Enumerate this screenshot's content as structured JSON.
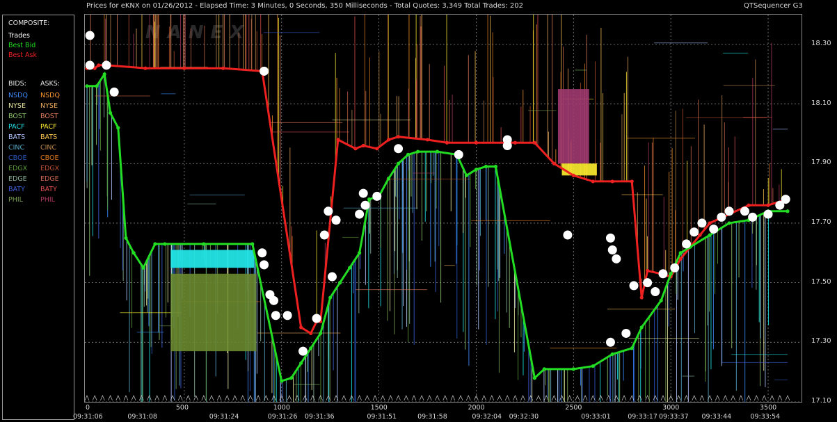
{
  "header": {
    "title": "Prices for  eKNX  on  01/26/2012  -  Elapsed Time: 3 Minutes, 0 Seconds, 350 Milliseconds  -  Total Quotes: 3,349  Total Trades: 202",
    "brand": "QTSequencer G3",
    "watermark": "NANEX"
  },
  "legend": {
    "composite_heading": "COMPOSITE:",
    "composite": [
      {
        "label": "Trades",
        "color": "#ffffff"
      },
      {
        "label": "Best Bid",
        "color": "#22dd22"
      },
      {
        "label": "Best Ask",
        "color": "#ee2020"
      }
    ],
    "bids_heading": "BIDS:",
    "asks_heading": "ASKS:",
    "bids": [
      {
        "label": "NSDQ",
        "color": "#3d8cff"
      },
      {
        "label": "NYSE",
        "color": "#e8e8a0"
      },
      {
        "label": "BOST",
        "color": "#8fc870"
      },
      {
        "label": "PACF",
        "color": "#22e4e4"
      },
      {
        "label": "BATS",
        "color": "#b0c8ff"
      },
      {
        "label": "CINC",
        "color": "#58a8c8"
      },
      {
        "label": "CBOE",
        "color": "#2c58c0"
      },
      {
        "label": "EDGX",
        "color": "#5a9a3a"
      },
      {
        "label": "EDGE",
        "color": "#8ab8a0"
      },
      {
        "label": "BATY",
        "color": "#4060d8"
      },
      {
        "label": "PHIL",
        "color": "#7aa050"
      }
    ],
    "asks": [
      {
        "label": "NSDQ",
        "color": "#ff9a30"
      },
      {
        "label": "NYSE",
        "color": "#f0b060"
      },
      {
        "label": "BOST",
        "color": "#e88060"
      },
      {
        "label": "PACF",
        "color": "#ffee30"
      },
      {
        "label": "BATS",
        "color": "#ffc850"
      },
      {
        "label": "CINC",
        "color": "#c08a50"
      },
      {
        "label": "CBOE",
        "color": "#e07a20"
      },
      {
        "label": "EDGX",
        "color": "#c05030"
      },
      {
        "label": "EDGE",
        "color": "#d06a50"
      },
      {
        "label": "BATY",
        "color": "#e05050"
      },
      {
        "label": "PHIL",
        "color": "#b03a60"
      }
    ]
  },
  "chart_data": {
    "type": "line",
    "title": "Prices for  eKNX  on  01/26/2012",
    "xlabel": "",
    "ylabel": "",
    "xlim": [
      0,
      3600
    ],
    "ylim": [
      17.1,
      18.4
    ],
    "grid": true,
    "x_ticks": [
      0,
      500,
      1000,
      1500,
      2000,
      2500,
      3000,
      3500
    ],
    "y_ticks": [
      17.1,
      17.3,
      17.5,
      17.7,
      17.9,
      18.1,
      18.3
    ],
    "y_tick_labels": [
      "17.10",
      "17.30",
      "17.50",
      "17.70",
      "17.90",
      "18.10",
      "18.30"
    ],
    "time_labels": [
      {
        "x": 0,
        "label": "09:31:06"
      },
      {
        "x": 280,
        "label": "09:31:08"
      },
      {
        "x": 700,
        "label": "09:31:24"
      },
      {
        "x": 1000,
        "label": "09:31:26"
      },
      {
        "x": 1190,
        "label": "09:31:36"
      },
      {
        "x": 1510,
        "label": "09:31:51"
      },
      {
        "x": 1770,
        "label": "09:31:58"
      },
      {
        "x": 2050,
        "label": "09:32:04"
      },
      {
        "x": 2240,
        "label": "09:32:30"
      },
      {
        "x": 2610,
        "label": "09:33:01"
      },
      {
        "x": 2850,
        "label": "09:33:17"
      },
      {
        "x": 3010,
        "label": "09:33:37"
      },
      {
        "x": 3230,
        "label": "09:33:44"
      },
      {
        "x": 3480,
        "label": "09:33:54"
      }
    ],
    "series": [
      {
        "name": "Best Ask",
        "color": "#ee2020",
        "points": [
          [
            0,
            18.22
          ],
          [
            40,
            18.22
          ],
          [
            60,
            18.23
          ],
          [
            100,
            18.23
          ],
          [
            300,
            18.22
          ],
          [
            500,
            18.22
          ],
          [
            700,
            18.22
          ],
          [
            900,
            18.21
          ],
          [
            1100,
            17.35
          ],
          [
            1150,
            17.33
          ],
          [
            1180,
            17.37
          ],
          [
            1200,
            17.37
          ],
          [
            1290,
            17.98
          ],
          [
            1380,
            17.95
          ],
          [
            1420,
            17.96
          ],
          [
            1490,
            17.95
          ],
          [
            1550,
            17.98
          ],
          [
            1600,
            17.99
          ],
          [
            1750,
            17.98
          ],
          [
            1850,
            17.97
          ],
          [
            2000,
            17.97
          ],
          [
            2200,
            17.97
          ],
          [
            2300,
            17.97
          ],
          [
            2400,
            17.9
          ],
          [
            2500,
            17.86
          ],
          [
            2600,
            17.84
          ],
          [
            2700,
            17.84
          ],
          [
            2800,
            17.84
          ],
          [
            2850,
            17.45
          ],
          [
            2880,
            17.54
          ],
          [
            2950,
            17.53
          ],
          [
            3000,
            17.52
          ],
          [
            3050,
            17.58
          ],
          [
            3150,
            17.66
          ],
          [
            3200,
            17.7
          ],
          [
            3300,
            17.73
          ],
          [
            3400,
            17.76
          ],
          [
            3500,
            17.76
          ],
          [
            3600,
            17.78
          ]
        ]
      },
      {
        "name": "Best Bid",
        "color": "#22dd22",
        "points": [
          [
            0,
            18.16
          ],
          [
            50,
            18.16
          ],
          [
            90,
            18.2
          ],
          [
            120,
            18.07
          ],
          [
            160,
            18.02
          ],
          [
            200,
            17.65
          ],
          [
            240,
            17.6
          ],
          [
            290,
            17.55
          ],
          [
            350,
            17.63
          ],
          [
            400,
            17.63
          ],
          [
            600,
            17.63
          ],
          [
            850,
            17.63
          ],
          [
            1000,
            17.17
          ],
          [
            1050,
            17.18
          ],
          [
            1100,
            17.23
          ],
          [
            1150,
            17.28
          ],
          [
            1200,
            17.33
          ],
          [
            1250,
            17.45
          ],
          [
            1300,
            17.5
          ],
          [
            1350,
            17.55
          ],
          [
            1400,
            17.6
          ],
          [
            1450,
            17.78
          ],
          [
            1500,
            17.79
          ],
          [
            1550,
            17.85
          ],
          [
            1600,
            17.9
          ],
          [
            1650,
            17.93
          ],
          [
            1700,
            17.94
          ],
          [
            1800,
            17.94
          ],
          [
            1900,
            17.93
          ],
          [
            1950,
            17.86
          ],
          [
            2000,
            17.88
          ],
          [
            2050,
            17.89
          ],
          [
            2100,
            17.89
          ],
          [
            2300,
            17.18
          ],
          [
            2350,
            17.21
          ],
          [
            2500,
            17.21
          ],
          [
            2600,
            17.22
          ],
          [
            2700,
            17.26
          ],
          [
            2800,
            17.28
          ],
          [
            2850,
            17.35
          ],
          [
            2950,
            17.44
          ],
          [
            3000,
            17.53
          ],
          [
            3050,
            17.6
          ],
          [
            3100,
            17.62
          ],
          [
            3200,
            17.66
          ],
          [
            3300,
            17.7
          ],
          [
            3400,
            17.71
          ],
          [
            3500,
            17.74
          ],
          [
            3600,
            17.74
          ]
        ]
      },
      {
        "name": "Trades",
        "color": "#ffffff",
        "points": [
          [
            15,
            18.33
          ],
          [
            15,
            18.23
          ],
          [
            100,
            18.23
          ],
          [
            140,
            18.14
          ],
          [
            910,
            18.21
          ],
          [
            900,
            17.6
          ],
          [
            910,
            17.56
          ],
          [
            940,
            17.46
          ],
          [
            960,
            17.44
          ],
          [
            970,
            17.39
          ],
          [
            1030,
            17.39
          ],
          [
            1110,
            17.27
          ],
          [
            1180,
            17.38
          ],
          [
            1220,
            17.66
          ],
          [
            1240,
            17.74
          ],
          [
            1280,
            17.71
          ],
          [
            1260,
            17.52
          ],
          [
            1400,
            17.73
          ],
          [
            1420,
            17.8
          ],
          [
            1430,
            17.76
          ],
          [
            1490,
            17.79
          ],
          [
            1600,
            17.95
          ],
          [
            1910,
            17.93
          ],
          [
            2160,
            17.96
          ],
          [
            2160,
            17.98
          ],
          [
            2470,
            17.66
          ],
          [
            2690,
            17.65
          ],
          [
            2700,
            17.61
          ],
          [
            2720,
            17.58
          ],
          [
            2690,
            17.3
          ],
          [
            2770,
            17.33
          ],
          [
            2810,
            17.49
          ],
          [
            2880,
            17.5
          ],
          [
            2920,
            17.47
          ],
          [
            2960,
            17.53
          ],
          [
            3020,
            17.55
          ],
          [
            3080,
            17.63
          ],
          [
            3120,
            17.67
          ],
          [
            3160,
            17.7
          ],
          [
            3220,
            17.68
          ],
          [
            3260,
            17.72
          ],
          [
            3300,
            17.74
          ],
          [
            3380,
            17.74
          ],
          [
            3420,
            17.72
          ],
          [
            3500,
            17.73
          ],
          [
            3560,
            17.76
          ],
          [
            3590,
            17.78
          ]
        ]
      }
    ]
  }
}
